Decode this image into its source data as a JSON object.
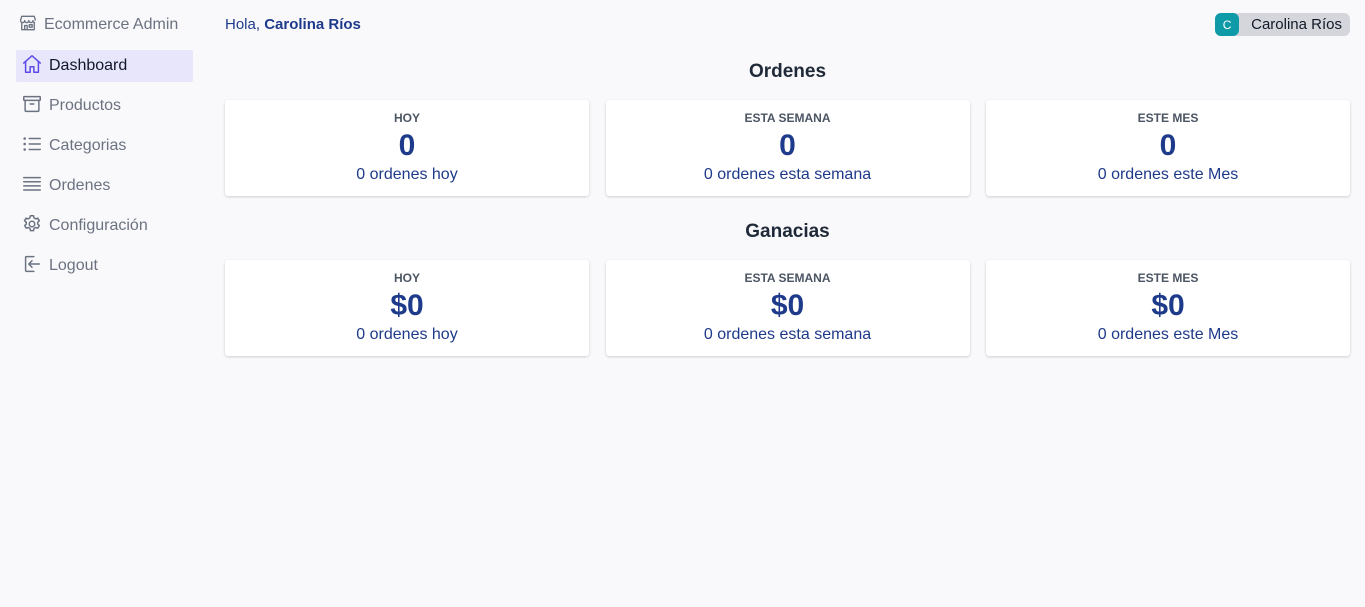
{
  "sidebar": {
    "brand": "Ecommerce Admin",
    "items": [
      {
        "label": "Dashboard",
        "icon": "home-icon"
      },
      {
        "label": "Productos",
        "icon": "archive-box-icon"
      },
      {
        "label": "Categorias",
        "icon": "list-icon"
      },
      {
        "label": "Ordenes",
        "icon": "queue-list-icon"
      },
      {
        "label": "Configuración",
        "icon": "gear-icon"
      },
      {
        "label": "Logout",
        "icon": "logout-icon"
      }
    ]
  },
  "header": {
    "greeting_prefix": "Hola,",
    "greeting_name": "Carolina Ríos",
    "user": {
      "initial": "C",
      "name": "Carolina Ríos"
    }
  },
  "sections": [
    {
      "title": "Ordenes",
      "cards": [
        {
          "label": "HOY",
          "value": "0",
          "sub": "0 ordenes hoy"
        },
        {
          "label": "ESTA SEMANA",
          "value": "0",
          "sub": "0 ordenes esta semana"
        },
        {
          "label": "ESTE MES",
          "value": "0",
          "sub": "0 ordenes este Mes"
        }
      ]
    },
    {
      "title": "Ganacias",
      "cards": [
        {
          "label": "HOY",
          "value": "$0",
          "sub": "0 ordenes hoy"
        },
        {
          "label": "ESTA SEMANA",
          "value": "$0",
          "sub": "0 ordenes esta semana"
        },
        {
          "label": "ESTE MES",
          "value": "$0",
          "sub": "0 ordenes este Mes"
        }
      ]
    }
  ],
  "colors": {
    "accent": "#1e3a8a",
    "active_nav_bg": "#e7e6fb",
    "avatar_bg": "#0e9aa7",
    "page_bg": "#f9f9fc"
  }
}
